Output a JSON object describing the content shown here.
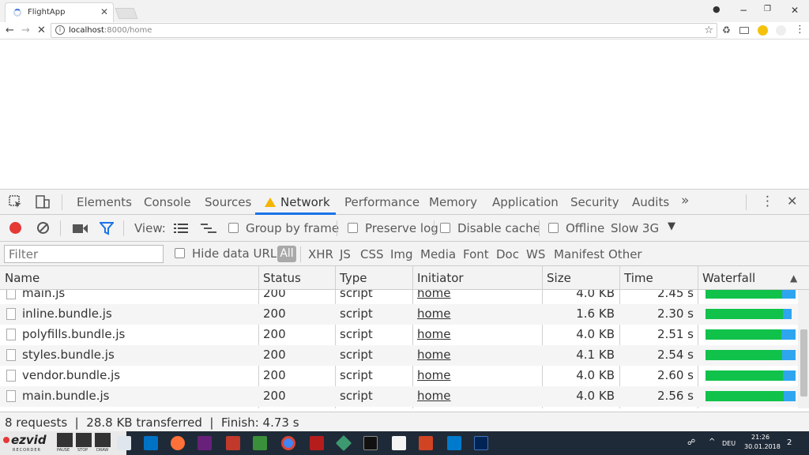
{
  "browser": {
    "tab_title": "FlightApp",
    "tab_close": "✕",
    "url_host": "localhost",
    "url_rest": ":8000/home",
    "window_controls": [
      "−",
      "❐",
      "✕"
    ]
  },
  "devtools": {
    "tabs": [
      "Elements",
      "Console",
      "Sources",
      "Network",
      "Performance",
      "Memory",
      "Application",
      "Security",
      "Audits"
    ],
    "more_tabs": "»",
    "kebab": "⋮",
    "close": "✕",
    "toolbar": {
      "view_label": "View:",
      "group_by_frame": "Group by frame",
      "preserve_log": "Preserve log",
      "disable_cache": "Disable cache",
      "offline": "Offline",
      "throttle": "Slow 3G"
    },
    "filter_placeholder": "Filter",
    "hide_data_urls": "Hide data URLs",
    "filter_types": [
      "All",
      "XHR",
      "JS",
      "CSS",
      "Img",
      "Media",
      "Font",
      "Doc",
      "WS",
      "Manifest",
      "Other"
    ],
    "columns": [
      "Name",
      "Status",
      "Type",
      "Initiator",
      "Size",
      "Time",
      "Waterfall"
    ],
    "rows": [
      {
        "name": "main.js",
        "status": "200",
        "type": "script",
        "initiator": "home",
        "size": "4.0 KB",
        "time": "2.45 s",
        "waterfall": {
          "green": 0.85,
          "blue": 0.15
        }
      },
      {
        "name": "inline.bundle.js",
        "status": "200",
        "type": "script",
        "initiator": "home",
        "size": "1.6 KB",
        "time": "2.30 s",
        "waterfall": {
          "green": 0.86,
          "blue": 0.1
        }
      },
      {
        "name": "polyfills.bundle.js",
        "status": "200",
        "type": "script",
        "initiator": "home",
        "size": "4.0 KB",
        "time": "2.51 s",
        "waterfall": {
          "green": 0.84,
          "blue": 0.16
        }
      },
      {
        "name": "styles.bundle.js",
        "status": "200",
        "type": "script",
        "initiator": "home",
        "size": "4.1 KB",
        "time": "2.54 s",
        "waterfall": {
          "green": 0.85,
          "blue": 0.15
        }
      },
      {
        "name": "vendor.bundle.js",
        "status": "200",
        "type": "script",
        "initiator": "home",
        "size": "4.0 KB",
        "time": "2.60 s",
        "waterfall": {
          "green": 0.86,
          "blue": 0.14
        }
      },
      {
        "name": "main.bundle.js",
        "status": "200",
        "type": "script",
        "initiator": "home",
        "size": "4.0 KB",
        "time": "2.56 s",
        "waterfall": {
          "green": 0.87,
          "blue": 0.13
        }
      }
    ],
    "status_bar": "8 requests  |  28.8 KB transferred  |  Finish: 4.73 s"
  },
  "taskbar": {
    "recorder": "ezvid",
    "recorder_sub": "RECORDER",
    "recorder_buttons": [
      "PAUSE",
      "STOP",
      "DRAW"
    ],
    "language": "DEU",
    "time": "21:26",
    "date": "30.01.2018",
    "notifications": "2"
  },
  "colors": {
    "accent": "#1a73e8",
    "record": "#e53935",
    "waterfall_green": "#10c24a",
    "waterfall_blue": "#2fa5f0",
    "warning": "#f4b400"
  }
}
